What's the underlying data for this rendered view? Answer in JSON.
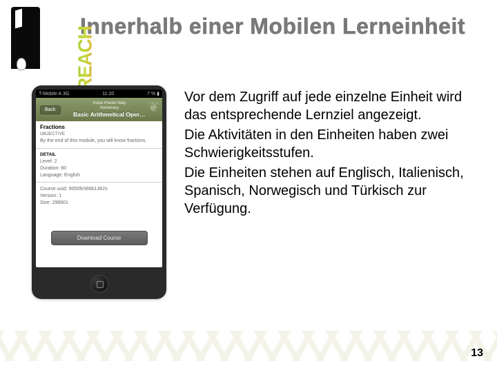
{
  "logo": {
    "brand": "REACH"
  },
  "title": "Innerhalb einer Mobilen Lerneinheit",
  "phone": {
    "status": {
      "carrier": "T-Mobile A",
      "signal": "3G",
      "time": "11:20",
      "battery": "7 %"
    },
    "nav": {
      "back": "Back",
      "subtitle_top": "Rural Practic Way",
      "subtitle_mid": "Numeracy",
      "title": "Basic Arithmetical Oper…"
    },
    "section1": {
      "label": "Fractions",
      "sublabel": "OBJECTIVE",
      "text": "By the end of this module, you will know fractions."
    },
    "section2": {
      "label": "DETAIL",
      "level": "Level: 2",
      "duration": "Duration: 60",
      "language": "Language: English"
    },
    "section3": {
      "uuid": "Course uuid: 9050fe366b1382s",
      "version": "Version: 1",
      "size": "Size: 298901"
    },
    "download": "Download Course"
  },
  "paragraphs": {
    "p1": "Vor dem Zugriff auf jede einzelne Einheit wird das entsprechende Lernziel angezeigt.",
    "p2": "Die Aktivitäten in den Einheiten haben zwei Schwierigkeitsstufen.",
    "p3": "Die Einheiten stehen auf Englisch, Italienisch, Spanisch, Norwegisch und Türkisch zur Verfügung."
  },
  "page_number": "13"
}
